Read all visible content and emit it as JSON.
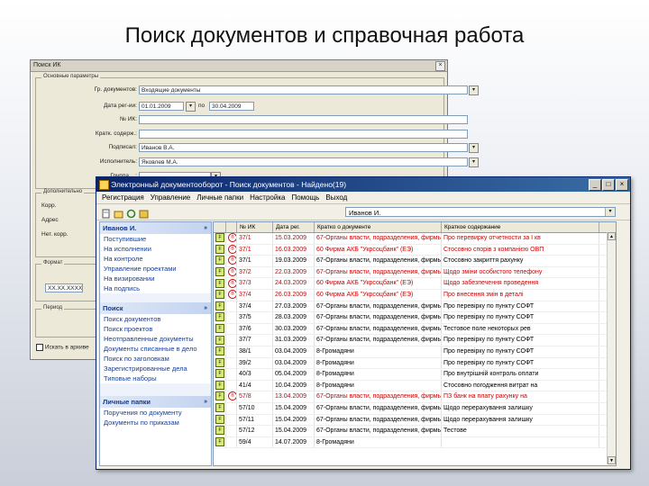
{
  "slide": {
    "title": "Поиск документов и справочная работа"
  },
  "dialog": {
    "title": "Поиск ИК",
    "close": "×",
    "group_main": "Основные параметры",
    "fields": [
      {
        "label": "Гр. документов:",
        "value": "Входящие документы",
        "dd": "▾"
      },
      {
        "label": "Дата рег-ии:",
        "value": "01.01.2009",
        "value2": "30.04.2009",
        "dd": "▾",
        "to": "по"
      },
      {
        "label": "№ ИК:",
        "value": ""
      },
      {
        "label": "Кратк. содерж.:",
        "value": ""
      },
      {
        "label": "Подписал:",
        "value": "Иванов В.А.",
        "dd": "▾"
      },
      {
        "label": "Исполнитель:",
        "value": "Яковлев М.А.",
        "dd": "▾"
      },
      {
        "label": "Группа ...:",
        "value": "",
        "dd": "▾"
      }
    ],
    "group_extra": "Дополнительно",
    "extra_labels": [
      "Корр.",
      "Адрес",
      "Нет. корр."
    ],
    "group_format": "Формат",
    "format_value": "XX.XX.XXXX",
    "group_period": "Период",
    "checkbox_label": "Искать в архиве"
  },
  "window": {
    "title": "Электронный документооборот - Поиск документов - Найдено(19)",
    "buttons": {
      "min": "_",
      "max": "□",
      "close": "×"
    },
    "menu": [
      "Регистрация",
      "Управление",
      "Личные папки",
      "Настройка",
      "Помощь",
      "Выход"
    ],
    "combo_value": "Иванов И.",
    "combo_dd": "▾"
  },
  "sidebar": {
    "user_head": "Иванов И.",
    "chev": "»",
    "user_items": [
      "Поступившие",
      "На исполнении",
      "На контроле",
      "Управление проектами",
      "На визировании",
      "На подпись"
    ],
    "search_head": "Поиск",
    "search_items": [
      "Поиск документов",
      "Поиск проектов",
      "Неотправленные документы",
      "Документы списанные в дело",
      "Поиск по заголовкам",
      "Зарегистрированные дела",
      "Типовые наборы"
    ],
    "personal_head": "Личные папки",
    "personal_items": [
      "Поручения по документу",
      "Документы по приказам"
    ]
  },
  "grid": {
    "headers": [
      "",
      "",
      "№ ИК",
      "Дата рег.",
      "Кратко о документе",
      "Краткое содержание"
    ],
    "rows": [
      {
        "flag": "F",
        "mark": "®",
        "num": "37/1",
        "date": "15.03.2009",
        "corr": "67-Органы власти, подразделения, фирмы",
        "summary": "Про перевирку отчетности за I кв",
        "red": true
      },
      {
        "flag": "F",
        "mark": "®",
        "num": "37/1",
        "date": "16.03.2009",
        "corr": "60 Фирма АКБ \"Укрсоцбанк\" (ЕЭ)",
        "summary": "Стосовно спорів з компанією ОВП",
        "red": true
      },
      {
        "flag": "F",
        "mark": "®",
        "num": "37/1",
        "date": "19.03.2009",
        "corr": "67-Органы власти, подразделения, фирмы",
        "summary": "Стосовно закриття рахунку",
        "red": false
      },
      {
        "flag": "F",
        "mark": "®",
        "num": "37/2",
        "date": "22.03.2009",
        "corr": "67-Органы власти, подразделения, фирмы",
        "summary": "Щодо зміни особистого телефону",
        "red": true
      },
      {
        "flag": "F",
        "mark": "®",
        "num": "37/3",
        "date": "24.03.2009",
        "corr": "60 Фирма АКБ \"Укрсоцбанк\" (ЕЭ)",
        "summary": "Щодо забезпечення проведення",
        "red": true
      },
      {
        "flag": "F",
        "mark": "®",
        "num": "37/4",
        "date": "26.03.2009",
        "corr": "60 Фирма АКБ \"Укрсоцбанк\" (ЕЭ)",
        "summary": "Про внесення змін в деталі",
        "red": true
      },
      {
        "flag": "F",
        "mark": "",
        "num": "37/4",
        "date": "27.03.2009",
        "corr": "67-Органы власти, подразделения, фирмы",
        "summary": "Про перевірку по пункту СОФТ",
        "red": false
      },
      {
        "flag": "F",
        "mark": "",
        "num": "37/5",
        "date": "28.03.2009",
        "corr": "67-Органы власти, подразделения, фирмы",
        "summary": "Про перевірку по пункту СОФТ",
        "red": false
      },
      {
        "flag": "F",
        "mark": "",
        "num": "37/6",
        "date": "30.03.2009",
        "corr": "67-Органы власти, подразделения, фирмы",
        "summary": "Тестовое поле некоторых рев",
        "red": false
      },
      {
        "flag": "F",
        "mark": "",
        "num": "37/7",
        "date": "31.03.2009",
        "corr": "67-Органы власти, подразделения, фирмы",
        "summary": "Про перевірку по пункту СОФТ",
        "red": false
      },
      {
        "flag": "F",
        "mark": "",
        "num": "38/1",
        "date": "03.04.2009",
        "corr": "8-Громадяни",
        "summary": "Про перевірку по пункту СОФТ",
        "red": false
      },
      {
        "flag": "F",
        "mark": "",
        "num": "39/2",
        "date": "03.04.2009",
        "corr": "8-Громадяни",
        "summary": "Про перевірку по пункту СОФТ",
        "red": false
      },
      {
        "flag": "F",
        "mark": "",
        "num": "40/3",
        "date": "05.04.2009",
        "corr": "8-Громадяни",
        "summary": "Про внутрішній контроль оплати",
        "red": false
      },
      {
        "flag": "F",
        "mark": "",
        "num": "41/4",
        "date": "10.04.2009",
        "corr": "8-Громадяни",
        "summary": "Стосовно погодження витрат на",
        "red": false
      },
      {
        "flag": "F",
        "mark": "®",
        "num": "57/8",
        "date": "13.04.2009",
        "corr": "67-Органы власти, подразделения, фирмы",
        "summary": "ПЗ банк на плату рахунку на",
        "red": true
      },
      {
        "flag": "F",
        "mark": "",
        "num": "57/10",
        "date": "15.04.2009",
        "corr": "67-Органы власти, подразделения, фирмы",
        "summary": "Щодо перерахування залишку",
        "red": false
      },
      {
        "flag": "F",
        "mark": "",
        "num": "57/11",
        "date": "15.04.2009",
        "corr": "67-Органы власти, подразделения, фирмы",
        "summary": "Щодо перерахування залишку",
        "red": false
      },
      {
        "flag": "F",
        "mark": "",
        "num": "57/12",
        "date": "15.04.2009",
        "corr": "67-Органы власти, подразделения, фирмы",
        "summary": "Тестове",
        "red": false
      },
      {
        "flag": "F",
        "mark": "",
        "num": "59/4",
        "date": "14.07.2009",
        "corr": "8-Громадяни",
        "summary": "",
        "red": false
      }
    ],
    "scroll_up": "▲",
    "scroll_down": "▼"
  }
}
